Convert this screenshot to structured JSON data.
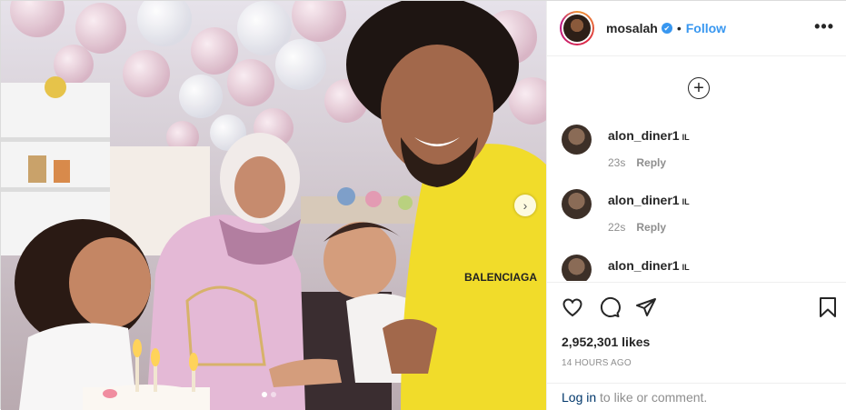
{
  "header": {
    "username": "mosalah",
    "verified_symbol": "✔",
    "separator": "•",
    "follow_label": "Follow",
    "more_label": "•••"
  },
  "comments": {
    "load_more_symbol": "+",
    "items": [
      {
        "user": "alon_diner1",
        "flag": "IL",
        "time": "23s",
        "reply": "Reply"
      },
      {
        "user": "alon_diner1",
        "flag": "IL",
        "time": "22s",
        "reply": "Reply"
      },
      {
        "user": "alon_diner1",
        "flag": "IL",
        "time": "",
        "reply": ""
      }
    ]
  },
  "actions": {
    "likes": "2,952,301 likes",
    "timestamp": "14 HOURS AGO"
  },
  "login": {
    "link": "Log in",
    "rest": " to like or comment."
  },
  "carousel": {
    "next_symbol": "›",
    "current_index": 1,
    "total": 2
  },
  "photo": {
    "shirt_text": "BALENCIAGA"
  },
  "colors": {
    "accent": "#3897f0",
    "text": "#262626",
    "muted": "#8e8e8e",
    "link": "#00376b"
  }
}
